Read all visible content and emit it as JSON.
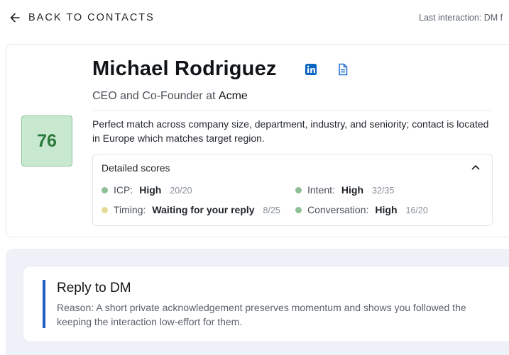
{
  "header": {
    "back_label": "BACK TO CONTACTS",
    "last_interaction": "Last interaction: DM f"
  },
  "contact": {
    "name": "Michael Rodriguez",
    "role": "CEO and Co-Founder",
    "at": "at",
    "company": "Acme",
    "score": "76",
    "summary": "Perfect match across company size, department, industry, and seniority; contact is located in Europe which matches target region."
  },
  "scores": {
    "heading": "Detailed scores",
    "items": [
      {
        "label": "ICP:",
        "value": "High",
        "fraction": "20/20",
        "color": "#8fbf94"
      },
      {
        "label": "Intent:",
        "value": "High",
        "fraction": "32/35",
        "color": "#8fbf94"
      },
      {
        "label": "Timing:",
        "value": "Waiting for your reply",
        "fraction": "8/25",
        "color": "#e4dc96"
      },
      {
        "label": "Conversation:",
        "value": "High",
        "fraction": "16/20",
        "color": "#8fbf94"
      }
    ]
  },
  "action": {
    "title": "Reply to DM",
    "reason_line1": "Reason: A short private acknowledgement preserves momentum and shows you followed the",
    "reason_line2": "keeping the interaction low-effort for them."
  },
  "colors": {
    "accent": "#1f5fbf",
    "linkedin": "#0a66c2",
    "score_bg": "#c8e8cf",
    "score_text": "#2b7a3d"
  },
  "icons": {
    "back": "arrow-left-icon",
    "linkedin": "linkedin-icon",
    "document": "document-icon",
    "collapse": "chevron-up-icon"
  }
}
